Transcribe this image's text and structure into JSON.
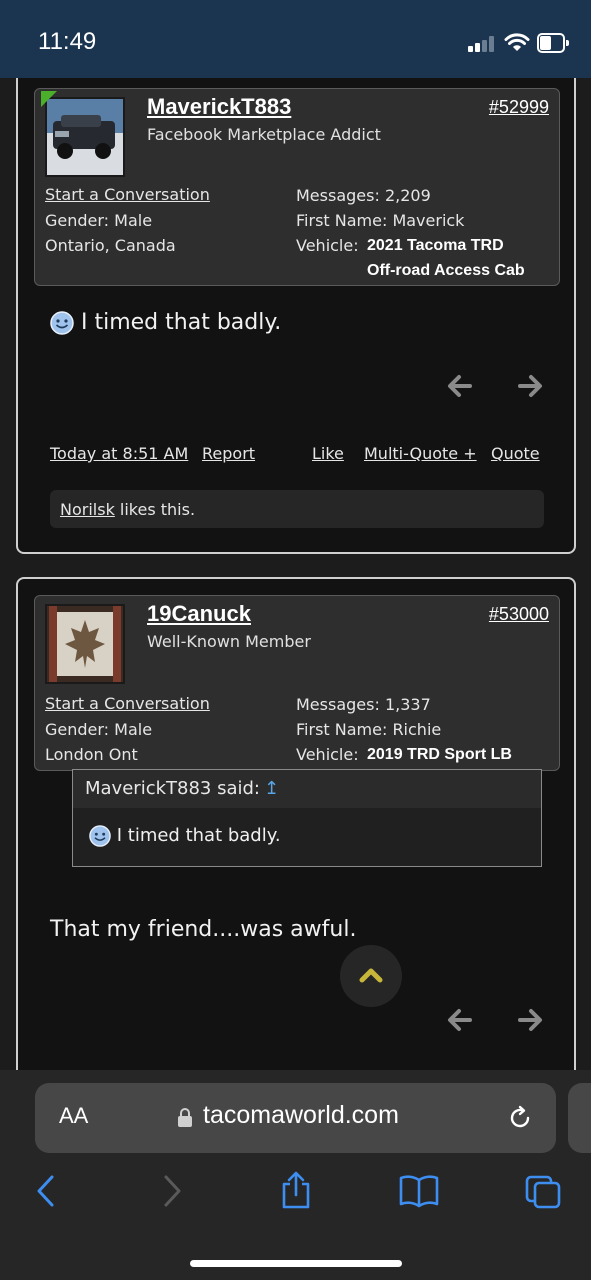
{
  "status": {
    "time": "11:49"
  },
  "posts": [
    {
      "username": "MaverickT883",
      "user_title": "Facebook Marketplace Addict",
      "post_number": "#52999",
      "start_conversation": "Start a Conversation",
      "gender": "Gender:  Male",
      "location": "Ontario, Canada",
      "messages": "Messages:  2,209",
      "first_name": "First Name:  Maverick",
      "vehicle_label": "Vehicle:",
      "vehicle_line1": "2021 Tacoma TRD",
      "vehicle_line2": "Off-road Access Cab",
      "message": "I timed that badly.",
      "time": "Today at 8:51 AM",
      "report": "Report",
      "like": "Like",
      "multi_quote": "Multi-Quote +",
      "quote": "Quote",
      "liked_by": "Norilsk",
      "likes_text": " likes this."
    },
    {
      "username": "19Canuck",
      "user_title": "Well-Known Member",
      "post_number": "#53000",
      "start_conversation": "Start a Conversation",
      "gender": "Gender:  Male",
      "location": "London Ont",
      "messages": "Messages:  1,337",
      "first_name": "First Name:  Richie",
      "vehicle_label": "Vehicle:",
      "vehicle_line1": "2019 TRD Sport LB",
      "quote_author": "MaverickT883 said:",
      "quote_up": "↥",
      "quote_text": "I timed that badly.",
      "message": "That my friend....was awful."
    }
  ],
  "browser": {
    "aa": "AA",
    "url": "tacomaworld.com"
  },
  "icons": {
    "smiley": "smiley-icon",
    "prev": "arrow-left-icon",
    "next": "arrow-right-icon",
    "scroll_top": "chevron-up-icon",
    "back": "back-chevron-icon",
    "forward": "forward-chevron-icon",
    "share": "share-icon",
    "bookmarks": "book-icon",
    "tabs": "tabs-icon"
  },
  "colors": {
    "status_bar": "#1b3550",
    "accent_blue": "#3d8ef0",
    "online": "#4caf2c",
    "scroll_chevron": "#c8b63a"
  }
}
